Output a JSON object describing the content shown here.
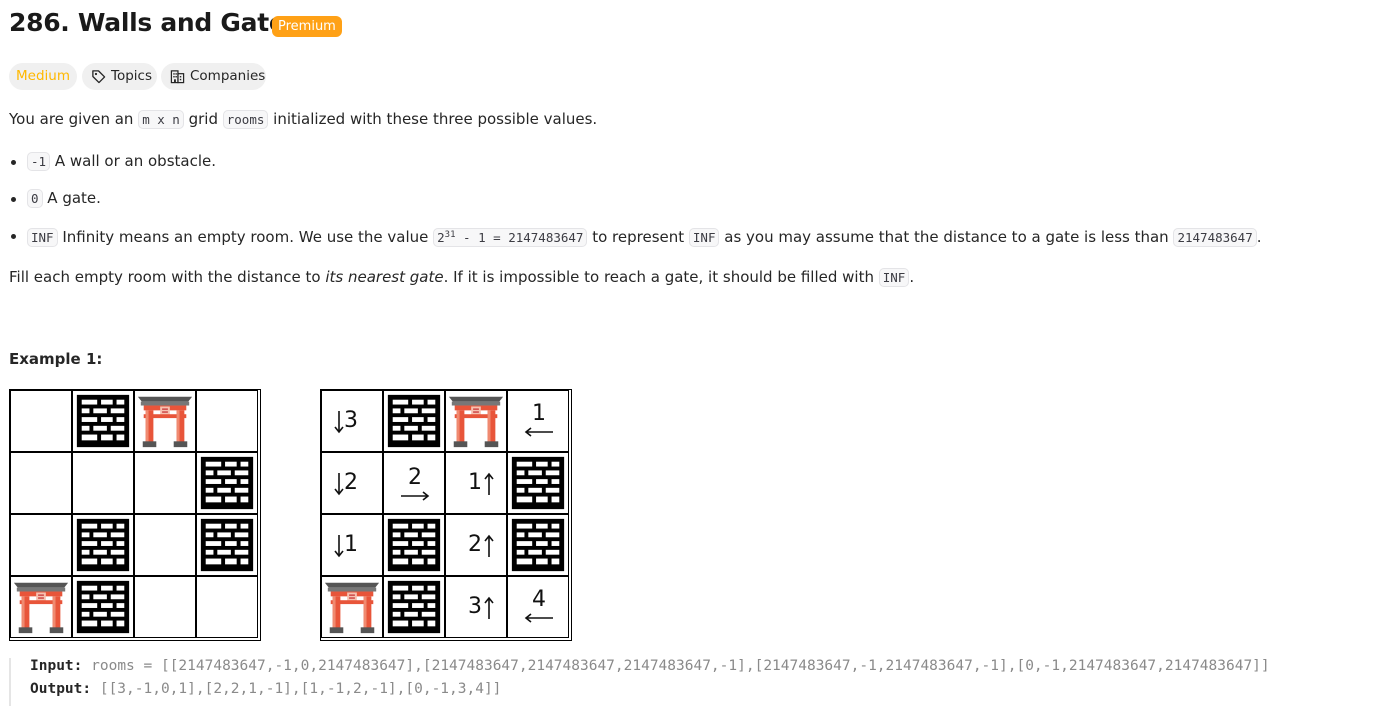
{
  "problem": {
    "title": "286. Walls and Gates",
    "badge": "Premium",
    "difficulty": "Medium",
    "topics_label": "Topics",
    "companies_label": "Companies"
  },
  "description": {
    "intro_1": "You are given an ",
    "intro_code_1": "m x n",
    "intro_2": " grid ",
    "intro_code_2": "rooms",
    "intro_3": " initialized with these three possible values.",
    "items": [
      {
        "code": "-1",
        "text": " A wall or an obstacle."
      },
      {
        "code": "0",
        "text": " A gate."
      },
      {
        "code": "INF",
        "text_1": " Infinity means an empty room. We use the value ",
        "code_2_base": "2",
        "code_2_sup": "31",
        "code_2_rest": " - 1 = 2147483647",
        "text_2": " to represent ",
        "code_3": "INF",
        "text_3": " as you may assume that the distance to a gate is less than ",
        "code_4": "2147483647",
        "text_4": "."
      }
    ],
    "fill_1": "Fill each empty room with the distance to ",
    "fill_em": "its nearest gate",
    "fill_2": ". If it is impossible to reach a gate, it should be filled with ",
    "fill_code": "INF",
    "fill_3": "."
  },
  "example": {
    "title": "Example 1:",
    "input_grid": [
      [
        "",
        "wall",
        "gate",
        ""
      ],
      [
        "",
        "",
        "",
        "wall"
      ],
      [
        "",
        "wall",
        "",
        "wall"
      ],
      [
        "gate",
        "wall",
        "",
        ""
      ]
    ],
    "output_grid": [
      [
        "↓3",
        "wall",
        "gate",
        "1←"
      ],
      [
        "↓2",
        "2→",
        "1↑",
        "wall"
      ],
      [
        "↓1",
        "wall",
        "2↑",
        "wall"
      ],
      [
        "gate",
        "wall",
        "3↑",
        "4←"
      ]
    ],
    "input_label": "Input:",
    "input_value": "rooms = [[2147483647,-1,0,2147483647],[2147483647,2147483647,2147483647,-1],[2147483647,-1,2147483647,-1],[0,-1,2147483647,2147483647]]",
    "output_label": "Output:",
    "output_value": "[[3,-1,0,1],[2,2,1,-1],[1,-1,2,-1],[0,-1,3,4]]"
  },
  "colors": {
    "accent": "#ffa116",
    "medium": "#ffb800",
    "gate_red": "#e8553a",
    "gate_roof": "#555555"
  },
  "icons": [
    "tag-icon",
    "building-icon",
    "wall-icon",
    "gate-icon",
    "arrow-down-icon",
    "arrow-up-icon",
    "arrow-left-icon",
    "arrow-right-icon"
  ]
}
